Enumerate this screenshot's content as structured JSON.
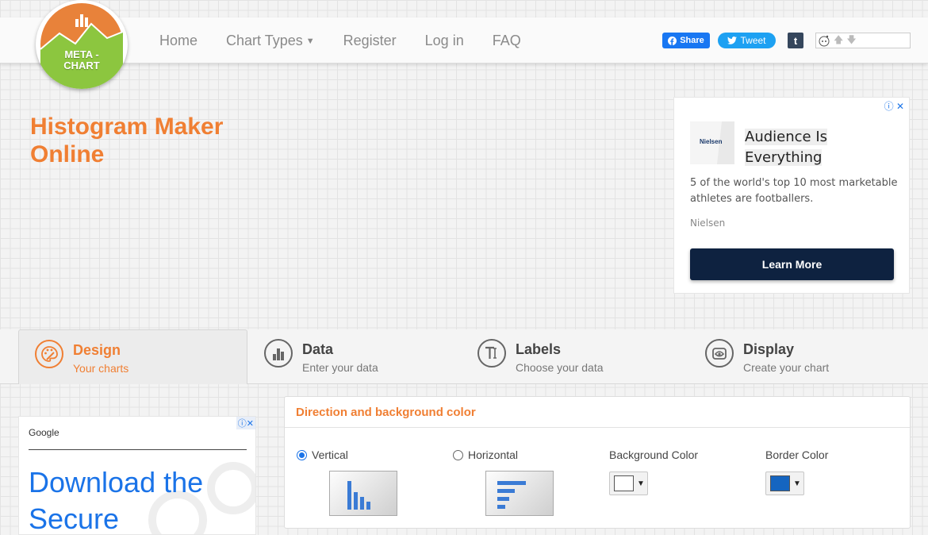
{
  "brand": {
    "logo_text_line1": "META -",
    "logo_text_line2": "CHART"
  },
  "nav": {
    "items": [
      {
        "label": "Home"
      },
      {
        "label": "Chart Types"
      },
      {
        "label": "Register"
      },
      {
        "label": "Log in"
      },
      {
        "label": "FAQ"
      }
    ]
  },
  "social": {
    "facebook_label": "Share",
    "twitter_label": "Tweet",
    "tumblr_label": "t"
  },
  "page": {
    "title": "Histogram Maker Online"
  },
  "ad_right": {
    "headline": "Audience Is Everything",
    "description": "5 of the world's top 10 most marketable athletes are footballers.",
    "brand": "Nielsen",
    "logo_text": "Nielsen",
    "cta": "Learn More"
  },
  "tabs": [
    {
      "name": "Design",
      "subtitle": "Your charts",
      "active": true
    },
    {
      "name": "Data",
      "subtitle": "Enter your data",
      "active": false
    },
    {
      "name": "Labels",
      "subtitle": "Choose your data",
      "active": false
    },
    {
      "name": "Display",
      "subtitle": "Create your chart",
      "active": false
    }
  ],
  "ad_left": {
    "label": "Google",
    "headline": "Download the Secure"
  },
  "panel": {
    "title": "Direction and background color",
    "vertical_label": "Vertical",
    "horizontal_label": "Horizontal",
    "background_color_label": "Background Color",
    "border_color_label": "Border Color",
    "background_color": "#ffffff",
    "border_color": "#1565c0",
    "selected_direction": "vertical"
  },
  "colors": {
    "accent": "#f07f33",
    "chart_blue": "#3a7bd5",
    "cta_navy": "#0e2240"
  }
}
